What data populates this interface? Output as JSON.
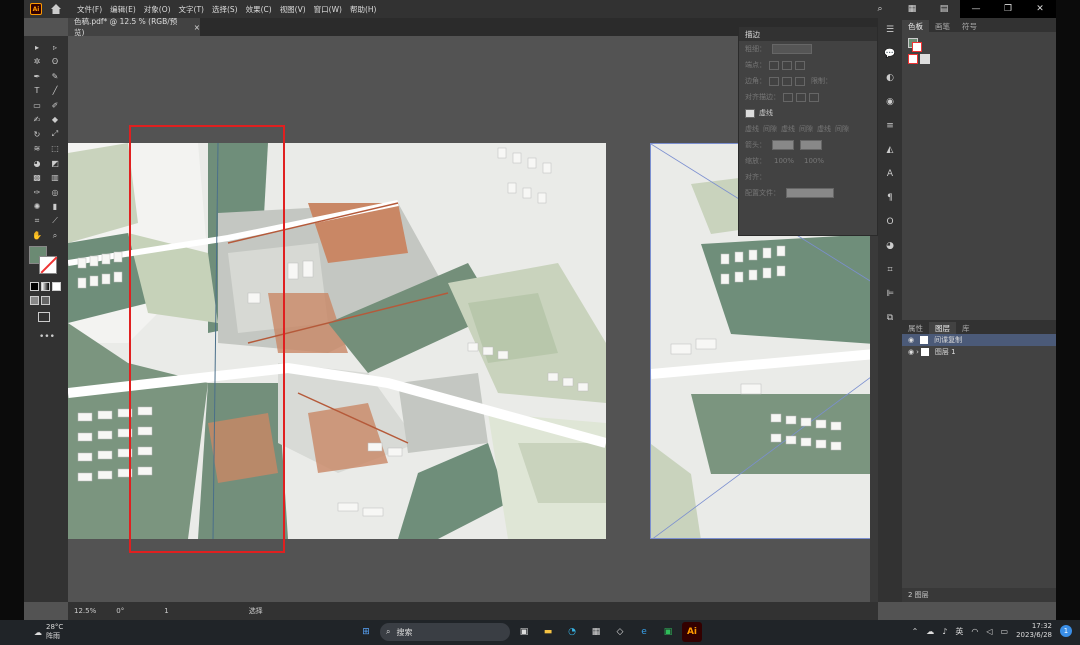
{
  "app": {
    "logo": "Ai"
  },
  "menu": [
    "文件(F)",
    "编辑(E)",
    "对象(O)",
    "文字(T)",
    "选择(S)",
    "效果(C)",
    "视图(V)",
    "窗口(W)",
    "帮助(H)"
  ],
  "document_tab": {
    "title": "色稿.pdf* @ 12.5 % (RGB/预览)",
    "close": "×"
  },
  "stroke_panel": {
    "title": "描边",
    "weight_label": "粗细：",
    "cap_label": "端点：",
    "corner_label": "边角：",
    "limit_label": "限制：",
    "align_label": "对齐描边：",
    "dashed_label": "虚线",
    "dash_labels": [
      "虚线",
      "间隙",
      "虚线",
      "间隙",
      "虚线",
      "间隙"
    ],
    "arrow_label": "箭头：",
    "scale_label": "缩放：",
    "scale_values": [
      "100%",
      "100%"
    ],
    "align2_label": "对齐：",
    "profile_label": "配置文件："
  },
  "right_panel": {
    "tabs": [
      "色板",
      "画笔",
      "符号"
    ],
    "layer_tabs": [
      "属性",
      "图层",
      "库"
    ],
    "layers": [
      {
        "name": "间谍复制"
      },
      {
        "name": "图层 1"
      }
    ],
    "footer": "2 图层"
  },
  "status": {
    "zoom": "12.5%",
    "angle": "0°",
    "page": "1",
    "mode": "选择"
  },
  "taskbar": {
    "temp": "28°C",
    "weather": "阵雨",
    "search": "搜索",
    "lang": "英",
    "time": "17:32",
    "date": "2023/6/28",
    "notif": "1"
  },
  "colors": {
    "selection": "#e02020",
    "fill": "#6b8a73",
    "accent": "#4a6fd0"
  }
}
